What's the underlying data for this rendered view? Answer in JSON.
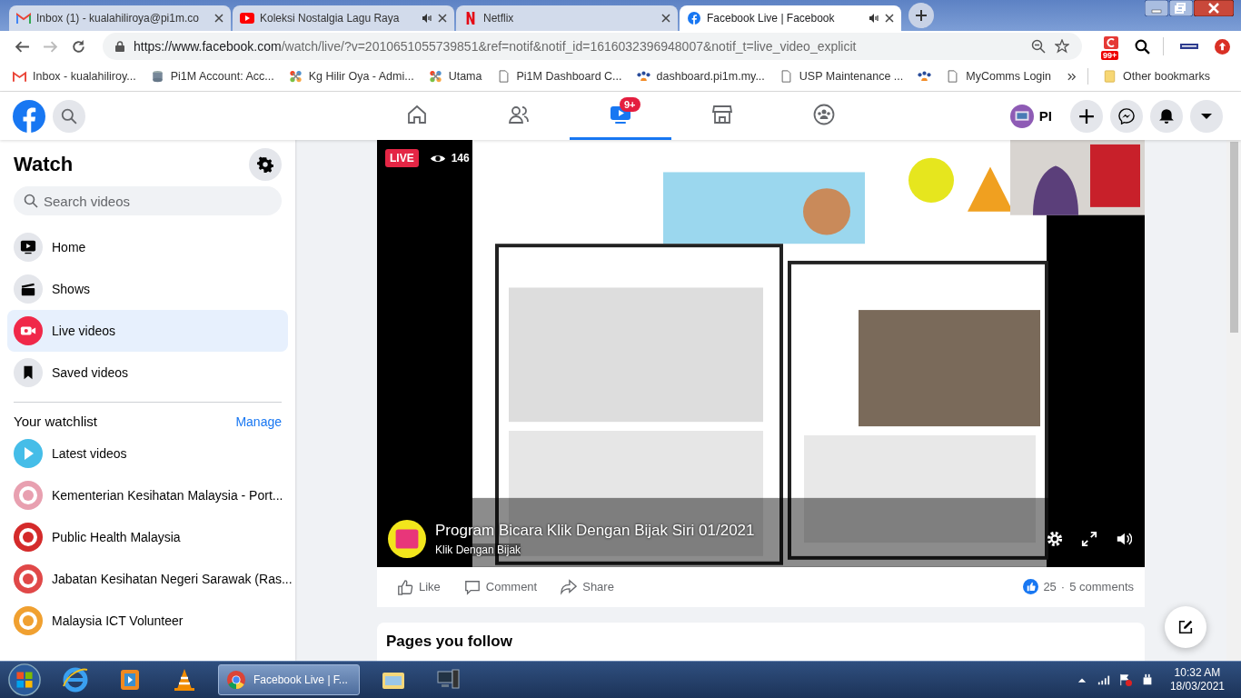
{
  "browser": {
    "tabs": [
      {
        "title": "Inbox (1) - kualahiliroya@pi1m.co",
        "kind": "mail",
        "audio": false,
        "selected": false
      },
      {
        "title": "Koleksi Nostalgia Lagu Raya",
        "kind": "video",
        "audio": true,
        "selected": false
      },
      {
        "title": "Netflix",
        "kind": "streaming",
        "audio": false,
        "selected": false
      },
      {
        "title": "Facebook Live | Facebook",
        "kind": "social",
        "audio": true,
        "selected": true
      }
    ],
    "url": {
      "host": "https://www.facebook.com",
      "path": "/watch/live/?v=2010651055739851&ref=notif&notif_id=1616032396948007&notif_t=live_video_explicit"
    },
    "extension_badge": "99+",
    "bookmarks": [
      {
        "label": "Inbox - kualahiliroy...",
        "kind": "mail"
      },
      {
        "label": "Pi1M Account: Acc...",
        "kind": "database"
      },
      {
        "label": "Kg Hilir Oya - Admi...",
        "kind": "pinwheel"
      },
      {
        "label": "Utama",
        "kind": "pinwheel"
      },
      {
        "label": "Pi1M Dashboard C...",
        "kind": "page"
      },
      {
        "label": "dashboard.pi1m.my...",
        "kind": "people"
      },
      {
        "label": "USP Maintenance ...",
        "kind": "page"
      },
      {
        "kind": "people"
      },
      {
        "label": "MyComms Login",
        "kind": "page"
      }
    ],
    "other_bookmarks": "Other bookmarks"
  },
  "facebook": {
    "nav": [
      {
        "kind": "home",
        "selected": false
      },
      {
        "kind": "friends",
        "selected": false
      },
      {
        "kind": "watch",
        "selected": true,
        "badge": "9+"
      },
      {
        "kind": "marketplace",
        "selected": false
      },
      {
        "kind": "groups",
        "selected": false
      }
    ],
    "profile_name": "PI",
    "sidebar": {
      "title": "Watch",
      "search_placeholder": "Search videos",
      "items": [
        {
          "label": "Home",
          "kind": "tv",
          "selected": false
        },
        {
          "label": "Shows",
          "kind": "clapper",
          "selected": false
        },
        {
          "label": "Live videos",
          "kind": "live",
          "selected": true
        },
        {
          "label": "Saved videos",
          "kind": "bookmark",
          "selected": false
        }
      ],
      "watchlist_title": "Your watchlist",
      "manage": "Manage",
      "watchlist": [
        {
          "label": "Latest videos",
          "kind": "play",
          "color": "#45bde8"
        },
        {
          "label": "Kementerian Kesihatan Malaysia - Port...",
          "kind": "avatar",
          "color": "#e8a0b0"
        },
        {
          "label": "Public Health Malaysia",
          "kind": "avatar",
          "color": "#d42a2a"
        },
        {
          "label": "Jabatan Kesihatan Negeri Sarawak (Ras...",
          "kind": "avatar",
          "color": "#e04848"
        },
        {
          "label": "Malaysia ICT Volunteer",
          "kind": "avatar",
          "color": "#f0a030"
        }
      ]
    },
    "video": {
      "live": "LIVE",
      "viewers": "146",
      "title": "Program Bicara Klik Dengan Bijak Siri 01/2021",
      "channel": "Klik Dengan Bijak"
    },
    "actions": [
      {
        "label": "Like",
        "kind": "like"
      },
      {
        "label": "Comment",
        "kind": "comment"
      },
      {
        "label": "Share",
        "kind": "share"
      }
    ],
    "reactions": "25",
    "separator": "·",
    "comments": "5 comments",
    "pages_title": "Pages you follow"
  },
  "taskbar": {
    "window": "Facebook Live | F...",
    "time": "10:32 AM",
    "date": "18/03/2021"
  }
}
